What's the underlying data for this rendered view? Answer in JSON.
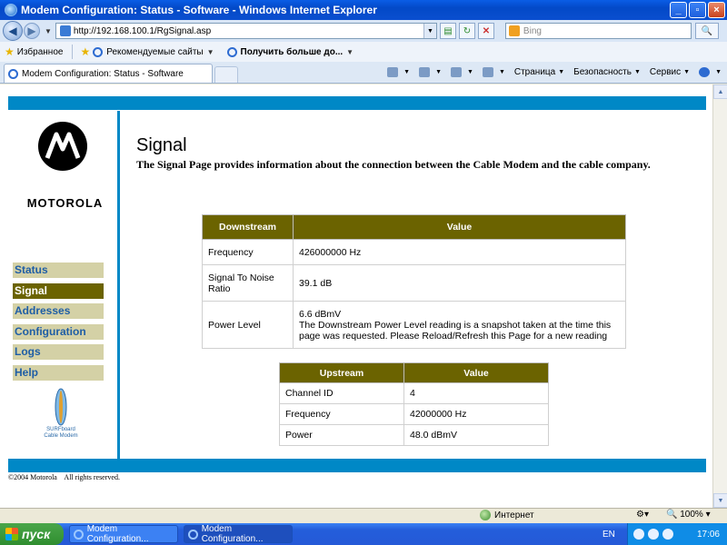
{
  "window": {
    "title": "Modem Configuration: Status - Software - Windows Internet Explorer"
  },
  "address": {
    "url": "http://192.168.100.1/RgSignal.asp",
    "search_placeholder": "Bing"
  },
  "favorites": {
    "label": "Избранное",
    "items": [
      "Рекомендуемые сайты",
      "Получить больше до..."
    ]
  },
  "tab": {
    "title": "Modem Configuration: Status - Software"
  },
  "commands": [
    "Страница",
    "Безопасность",
    "Сервис"
  ],
  "sidebar": {
    "brand": "MOTOROLA",
    "items": [
      {
        "label": "Status"
      },
      {
        "label": "Signal"
      },
      {
        "label": "Addresses"
      },
      {
        "label": "Configuration"
      },
      {
        "label": "Logs"
      },
      {
        "label": "Help"
      }
    ],
    "surf_logo": [
      "SURFboard",
      "Cable Modem"
    ]
  },
  "page": {
    "title": "Signal",
    "description": "The Signal Page provides information about the connection between the Cable Modem and the cable company."
  },
  "downstream": {
    "headers": [
      "Downstream",
      "Value"
    ],
    "rows": [
      {
        "label": "Frequency",
        "value": "426000000 Hz"
      },
      {
        "label": "Signal To Noise Ratio",
        "value": "39.1 dB"
      },
      {
        "label": "Power Level",
        "value": "6.6 dBmV",
        "note": "The Downstream Power Level reading is a snapshot taken at the time this page was requested. Please Reload/Refresh this Page for a new reading"
      }
    ]
  },
  "upstream": {
    "headers": [
      "Upstream",
      "Value"
    ],
    "rows": [
      {
        "label": "Channel ID",
        "value": "4"
      },
      {
        "label": "Frequency",
        "value": "42000000 Hz"
      },
      {
        "label": "Power",
        "value": "48.0 dBmV"
      }
    ]
  },
  "footer": {
    "copyright": "©2004 Motorola    All rights reserved."
  },
  "status": {
    "zone": "Интернет",
    "zoom": "100%"
  },
  "taskbar": {
    "start": "пуск",
    "tasks": [
      "Modem Configuration...",
      "Modem Configuration..."
    ],
    "lang": "EN",
    "clock": "17:06"
  },
  "colors": {
    "accent_blue": "#0088c6",
    "olive": "#6b6300",
    "nav_bg": "#d4d1a6",
    "nav_text": "#1f5ea5"
  }
}
